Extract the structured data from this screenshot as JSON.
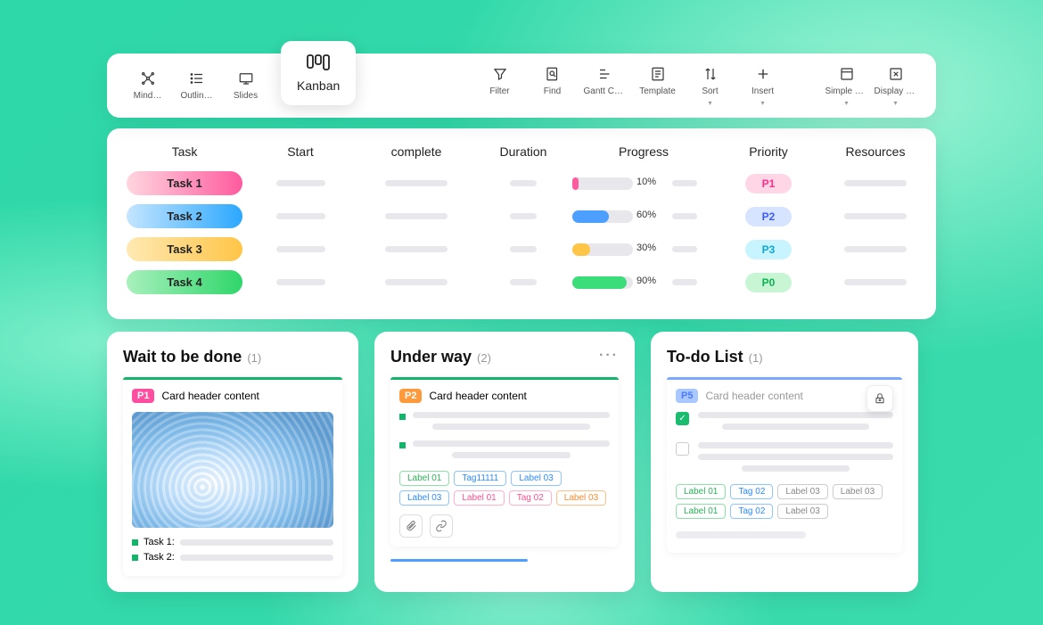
{
  "toolbar": {
    "items": [
      {
        "label": "Mind…",
        "name": "mindmap-tool"
      },
      {
        "label": "Outlin…",
        "name": "outline-tool"
      },
      {
        "label": "Slides",
        "name": "slides-tool"
      }
    ],
    "active": {
      "label": "Kanban",
      "name": "kanban-tool"
    },
    "right": [
      {
        "label": "Filter",
        "name": "filter-tool"
      },
      {
        "label": "Find",
        "name": "find-tool"
      },
      {
        "label": "Gantt Chart",
        "name": "gantt-tool"
      },
      {
        "label": "Template",
        "name": "template-tool"
      },
      {
        "label": "Sort",
        "name": "sort-tool",
        "dropdown": true
      },
      {
        "label": "Insert",
        "name": "insert-tool",
        "dropdown": true
      }
    ],
    "far": [
      {
        "label": "Simple Mode",
        "name": "simple-mode-tool",
        "dropdown": true
      },
      {
        "label": "Display Set",
        "name": "display-set-tool",
        "dropdown": true
      }
    ]
  },
  "table": {
    "headers": [
      "Task",
      "Start",
      "complete",
      "Duration",
      "Progress",
      "Priority",
      "Resources"
    ],
    "rows": [
      {
        "task": "Task 1",
        "pill": "pill-red",
        "progress": 10,
        "pclass": "prog-pink",
        "prio": "P1",
        "prclass": "prio-pink"
      },
      {
        "task": "Task 2",
        "pill": "pill-blue",
        "progress": 60,
        "pclass": "prog-blue",
        "prio": "P2",
        "prclass": "prio-blue"
      },
      {
        "task": "Task 3",
        "pill": "pill-yellow",
        "progress": 30,
        "pclass": "prog-yellow",
        "prio": "P3",
        "prclass": "prio-cyan"
      },
      {
        "task": "Task 4",
        "pill": "pill-green",
        "progress": 90,
        "pclass": "prog-green",
        "prio": "P0",
        "prclass": "prio-green"
      }
    ]
  },
  "boards": {
    "wait": {
      "title": "Wait to be done",
      "count": "(1)",
      "card": {
        "prio": "P1",
        "header": "Card header content",
        "tasks": [
          "Task 1:",
          "Task 2:"
        ]
      }
    },
    "under": {
      "title": "Under way",
      "count": "(2)",
      "more": "···",
      "card": {
        "prio": "P2",
        "header": "Card header content",
        "tags": [
          {
            "t": "Label 01",
            "c": "tag-green"
          },
          {
            "t": "Tag11111",
            "c": "tag-blue"
          },
          {
            "t": "Label 03",
            "c": "tag-blue"
          },
          {
            "t": "Label 03",
            "c": "tag-blue"
          },
          {
            "t": "Label 01",
            "c": "tag-pink"
          },
          {
            "t": "Tag 02",
            "c": "tag-pink"
          },
          {
            "t": "Label 03",
            "c": "tag-orange"
          }
        ]
      }
    },
    "todo": {
      "title": "To-do List",
      "count": "(1)",
      "card": {
        "prio": "P5",
        "header": "Card header content",
        "tags": [
          {
            "t": "Label 01",
            "c": "tag-green"
          },
          {
            "t": "Tag 02",
            "c": "tag-blue"
          },
          {
            "t": "Label 03",
            "c": "tag-gray"
          },
          {
            "t": "Label 03",
            "c": "tag-gray"
          },
          {
            "t": "Label 01",
            "c": "tag-green"
          },
          {
            "t": "Tag 02",
            "c": "tag-blue"
          },
          {
            "t": "Label 03",
            "c": "tag-gray"
          }
        ]
      }
    }
  }
}
